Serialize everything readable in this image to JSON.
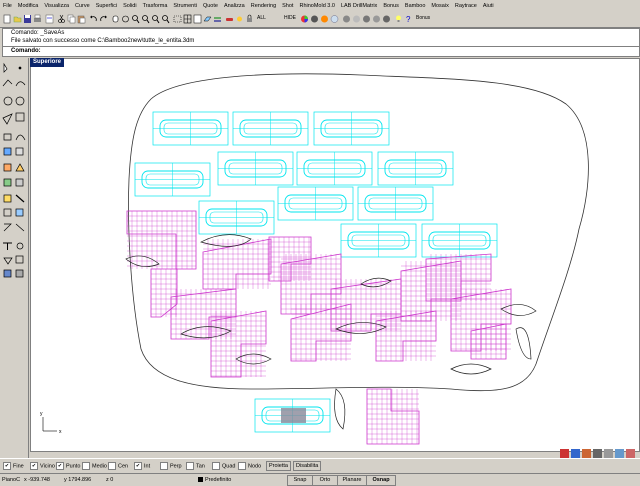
{
  "menu": [
    "File",
    "Modifica",
    "Visualizza",
    "Curve",
    "Superfici",
    "Solidi",
    "Trasforma",
    "Strumenti",
    "Quote",
    "Analizza",
    "Rendering",
    "Shot",
    "RhinoMold 3.0",
    "LAB DrillMatrix",
    "Bonus",
    "Bamboo",
    "Mosaix",
    "Raytrace",
    "Aiuti"
  ],
  "toolbar": {
    "all_label": "ALL",
    "hide_label": "HIDE",
    "bonus_label": "Bonus"
  },
  "command_history": [
    "Comando: _SaveAs",
    "File salvato con successo come C:\\Bamboo2new\\tutte_le_entita.3dm"
  ],
  "command_prompt": "Comando:",
  "viewport": {
    "name": "Superiore",
    "axis_x": "x",
    "axis_y": "y"
  },
  "osnap": [
    {
      "label": "Fine",
      "checked": true
    },
    {
      "label": "Vicino",
      "checked": true
    },
    {
      "label": "Punto",
      "checked": true
    },
    {
      "label": "Medio",
      "checked": false
    },
    {
      "label": "Cen",
      "checked": false
    },
    {
      "label": "Int",
      "checked": true
    },
    {
      "label": "Perp",
      "checked": false
    },
    {
      "label": "Tan",
      "checked": false
    },
    {
      "label": "Quad",
      "checked": false
    },
    {
      "label": "Nodo",
      "checked": false
    }
  ],
  "osnap_buttons": {
    "project": "Proietta",
    "disable": "Disabilita"
  },
  "status": {
    "cplane": "PianoC",
    "x": "x -939.748",
    "y": "y 1794.896",
    "z": "z 0",
    "layer": "Predefinito",
    "snap": "Snap",
    "ortho": "Orto",
    "planar": "Planare",
    "osnap": "Osnap"
  },
  "colors": {
    "cyan": "#00e5ee",
    "magenta": "#cc33cc",
    "title_blue": "#0a246a"
  }
}
